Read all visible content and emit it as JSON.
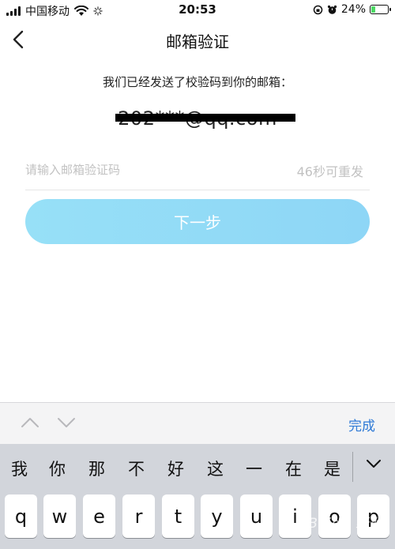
{
  "status_bar": {
    "carrier": "中国移动",
    "time": "20:53",
    "battery_text": "24%",
    "battery_level": 0.24
  },
  "nav": {
    "title": "邮箱验证"
  },
  "content": {
    "description": "我们已经发送了校验码到你的邮箱：",
    "email": "202***@qq.com",
    "code_placeholder": "请输入邮箱验证码",
    "resend_countdown": "46秒可重发",
    "next_label": "下一步"
  },
  "keyboard": {
    "done_label": "完成",
    "candidates": [
      "我",
      "你",
      "那",
      "不",
      "好",
      "这",
      "一",
      "在",
      "是"
    ],
    "keys": [
      "q",
      "w",
      "e",
      "r",
      "t",
      "y",
      "u",
      "i",
      "o",
      "p"
    ]
  },
  "watermark": "Baidu 经验",
  "colors": {
    "button": "#97e0f7",
    "done": "#2f7ad6",
    "placeholder": "#c2c2c2",
    "keyboard_bg": "#d2d5db"
  }
}
